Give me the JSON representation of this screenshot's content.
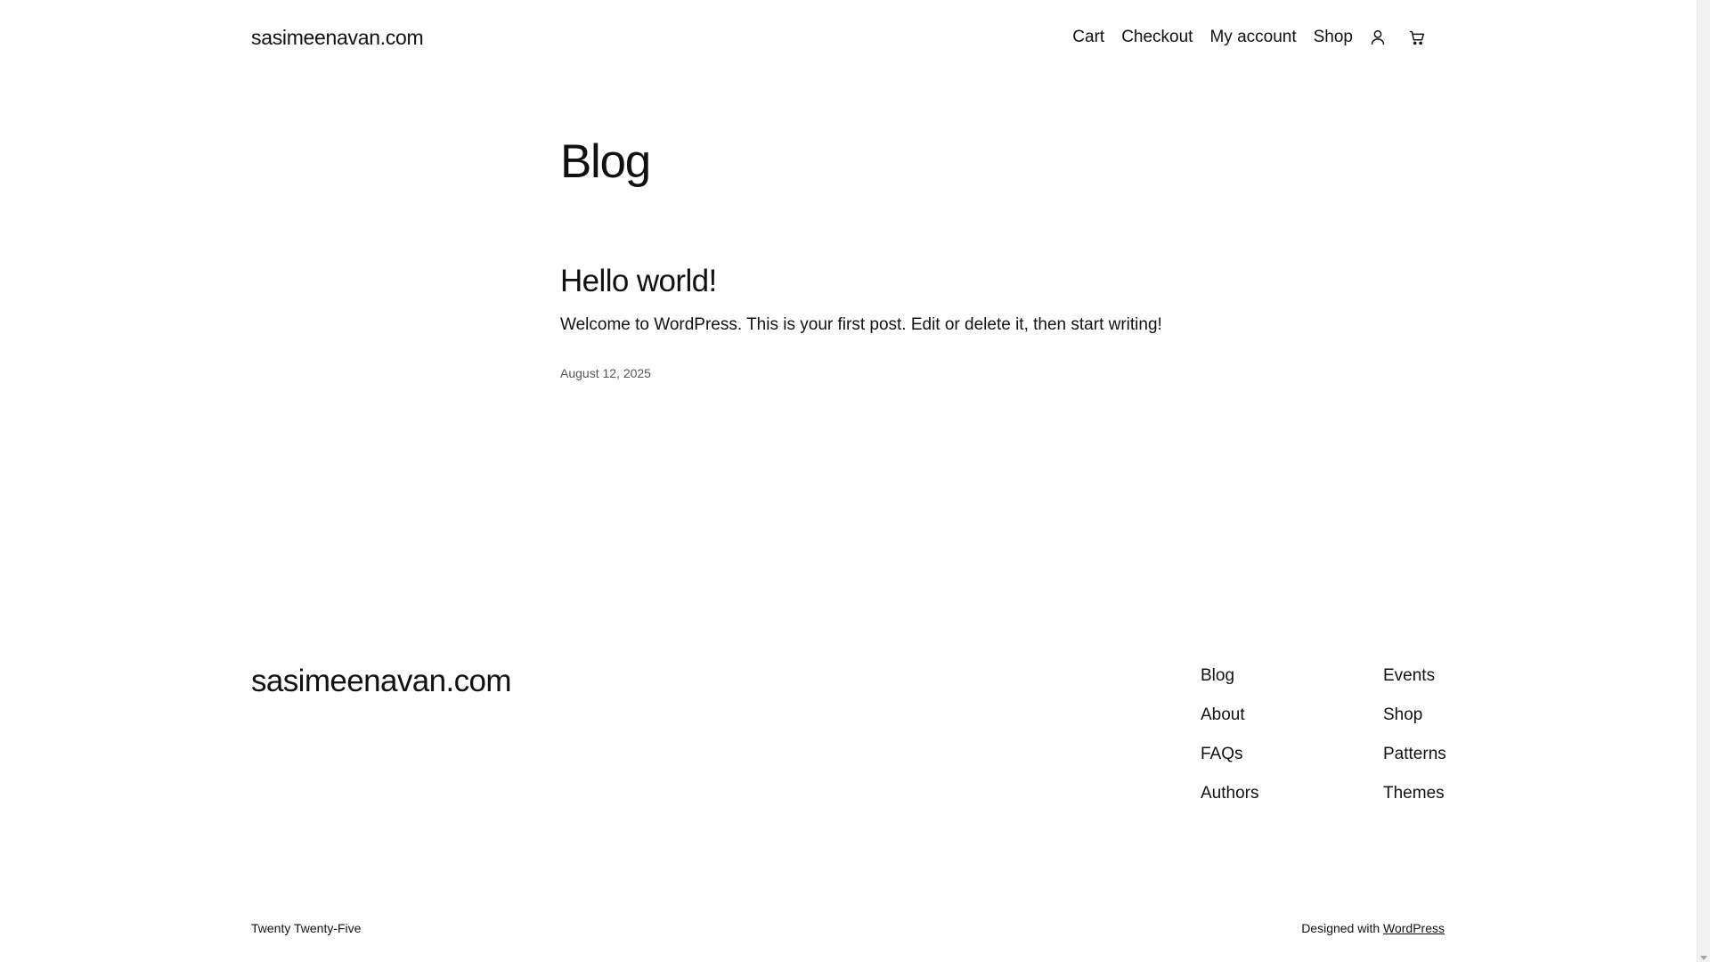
{
  "header": {
    "site_title": "sasimeenavan.com",
    "nav": [
      {
        "label": "Cart"
      },
      {
        "label": "Checkout"
      },
      {
        "label": "My account"
      },
      {
        "label": "Shop"
      }
    ],
    "icons": [
      "user-account-icon",
      "shopping-cart-icon"
    ]
  },
  "main": {
    "page_title": "Blog",
    "posts": [
      {
        "title": "Hello world!",
        "excerpt": "Welcome to WordPress. This is your first post. Edit or delete it, then start writing!",
        "date": "August 12, 2025"
      }
    ]
  },
  "footer": {
    "site_title": "sasimeenavan.com",
    "col1": [
      {
        "label": "Blog"
      },
      {
        "label": "About"
      },
      {
        "label": "FAQs"
      },
      {
        "label": "Authors"
      }
    ],
    "col2": [
      {
        "label": "Events"
      },
      {
        "label": "Shop"
      },
      {
        "label": "Patterns"
      },
      {
        "label": "Themes"
      }
    ],
    "theme_credit": "Twenty Twenty-Five",
    "designed_with_prefix": "Designed with",
    "designed_with_link": "WordPress"
  }
}
